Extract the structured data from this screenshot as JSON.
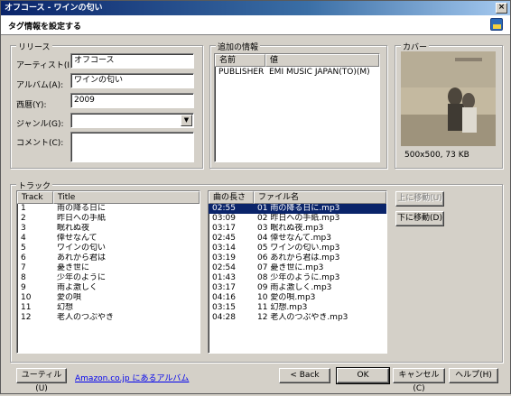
{
  "window": {
    "title": "オフコース - ワインの匂い",
    "close_glyph": "×"
  },
  "header": {
    "title": "タグ情報を設定する",
    "icon": "tag-settings-icon"
  },
  "release": {
    "group_label": "リリース",
    "artist_label": "アーティスト(I):",
    "artist_value": "オフコース",
    "album_label": "アルバム(A):",
    "album_value": "ワインの匂い",
    "year_label": "西暦(Y):",
    "year_value": "2009",
    "genre_label": "ジャンル(G):",
    "genre_value": "",
    "comment_label": "コメント(C):",
    "comment_value": ""
  },
  "extra": {
    "group_label": "追加の情報",
    "col_name": "名前",
    "col_value": "値",
    "rows": [
      {
        "name": "PUBLISHER",
        "value": "EMI MUSIC JAPAN(TO)(M)"
      }
    ]
  },
  "cover": {
    "group_label": "カバー",
    "info": "500x500, 73 KB"
  },
  "tracks": {
    "group_label": "トラック",
    "col_track": "Track",
    "col_title": "Title",
    "col_length": "曲の長さ",
    "col_file": "ファイル名",
    "rows": [
      {
        "track": "1",
        "title": "雨の降る日に",
        "length": "02:55",
        "file": "01 雨の降る日に.mp3"
      },
      {
        "track": "2",
        "title": "昨日への手紙",
        "length": "03:09",
        "file": "02 昨日への手紙.mp3"
      },
      {
        "track": "3",
        "title": "眠れぬ夜",
        "length": "03:17",
        "file": "03 眠れぬ夜.mp3"
      },
      {
        "track": "4",
        "title": "倖せなんて",
        "length": "02:45",
        "file": "04 倖せなんて.mp3"
      },
      {
        "track": "5",
        "title": "ワインの匂い",
        "length": "03:14",
        "file": "05 ワインの匂い.mp3"
      },
      {
        "track": "6",
        "title": "あれから君は",
        "length": "03:19",
        "file": "06 あれから君は.mp3"
      },
      {
        "track": "7",
        "title": "憂き世に",
        "length": "02:54",
        "file": "07 憂き世に.mp3"
      },
      {
        "track": "8",
        "title": "少年のように",
        "length": "01:43",
        "file": "08 少年のように.mp3"
      },
      {
        "track": "9",
        "title": "雨よ激しく",
        "length": "03:17",
        "file": "09 雨よ激しく.mp3"
      },
      {
        "track": "10",
        "title": "愛の唄",
        "length": "04:16",
        "file": "10 愛の唄.mp3"
      },
      {
        "track": "11",
        "title": "幻想",
        "length": "03:15",
        "file": "11 幻想.mp3"
      },
      {
        "track": "12",
        "title": "老人のつぶやき",
        "length": "04:28",
        "file": "12 老人のつぶやき.mp3"
      }
    ],
    "move_up_label": "上に移動(U)",
    "move_down_label": "下に移動(D)"
  },
  "footer": {
    "utility_label": "ユーティル(U)",
    "amazon_link": "Amazon.co.jp にあるアルバム",
    "back_label": "< Back",
    "ok_label": "OK",
    "cancel_label": "キャンセル(C)",
    "help_label": "ヘルプ(H)"
  },
  "colors": {
    "selection": "#0a246a",
    "link": "#0000ee",
    "titlebar": "#0a246a"
  }
}
